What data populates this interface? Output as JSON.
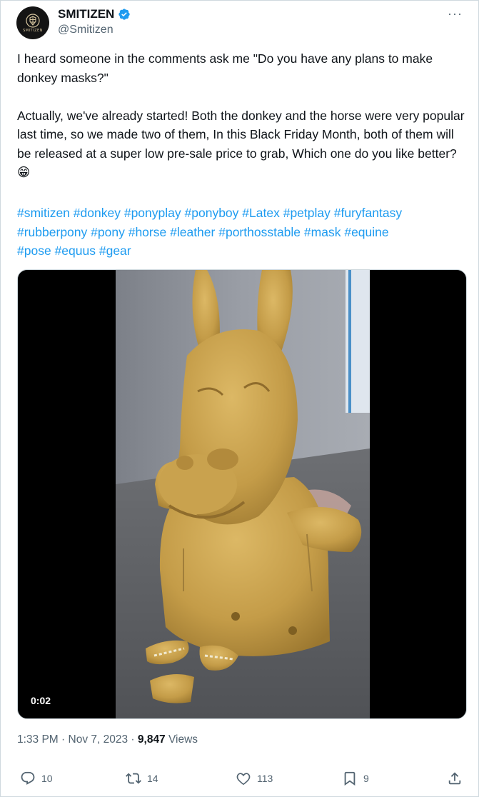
{
  "author": {
    "display_name": "SMITIZEN",
    "handle": "@Smitizen",
    "logo_text": "SMITIZEN",
    "verified": true
  },
  "menu": {
    "more_label": "···"
  },
  "tweet": {
    "paragraphs": [
      "I heard someone in the comments ask me \"Do you have any plans to make donkey masks?\"",
      "Actually, we've already started! Both the donkey and the horse were very popular last time, so we made two of them, In this Black Friday Month, both of them will be released at a super low pre-sale price to grab, Which one do you like better?😁"
    ],
    "hashtags": [
      "#smitizen",
      "#donkey",
      "#ponyplay",
      "#ponyboy",
      "#Latex",
      "#petplay",
      "#furyfantasy",
      "#rubberpony",
      "#pony",
      "#horse",
      "#leather",
      "#porthosstable",
      "#mask",
      "#equine",
      "#pose",
      "#equus",
      "#gear"
    ]
  },
  "media": {
    "timecode": "0:02"
  },
  "meta": {
    "time": "1:33 PM",
    "separator": " · ",
    "date": "Nov 7, 2023",
    "views_count": "9,847",
    "views_label": " Views"
  },
  "actions": {
    "replies": "10",
    "reposts": "14",
    "likes": "113",
    "bookmarks": "9"
  },
  "colors": {
    "accent": "#1d9bf0",
    "muted": "#536471",
    "text": "#0f1419",
    "sculpture": "#c9a24e"
  },
  "icons": [
    "verified-badge-icon",
    "more-icon",
    "reply-icon",
    "repost-icon",
    "like-icon",
    "bookmark-icon",
    "share-icon"
  ]
}
